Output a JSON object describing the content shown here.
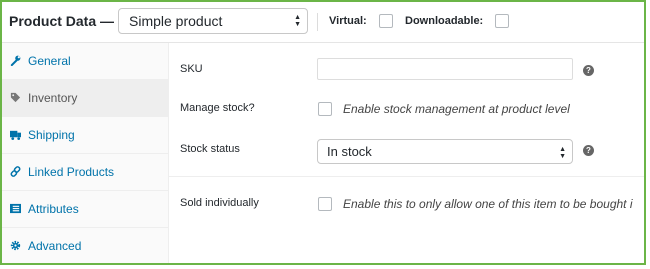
{
  "header": {
    "title": "Product Data —",
    "product_type": "Simple product",
    "virtual_label": "Virtual:",
    "downloadable_label": "Downloadable:"
  },
  "tabs": [
    {
      "label": "General",
      "icon": "wrench-icon"
    },
    {
      "label": "Inventory",
      "icon": "tag-icon"
    },
    {
      "label": "Shipping",
      "icon": "truck-icon"
    },
    {
      "label": "Linked Products",
      "icon": "link-icon"
    },
    {
      "label": "Attributes",
      "icon": "list-icon"
    },
    {
      "label": "Advanced",
      "icon": "gear-icon"
    }
  ],
  "active_tab": "Inventory",
  "fields": {
    "sku": {
      "label": "SKU",
      "value": ""
    },
    "manage_stock": {
      "label": "Manage stock?",
      "description": "Enable stock management at product level"
    },
    "stock_status": {
      "label": "Stock status",
      "value": "In stock"
    },
    "sold_individually": {
      "label": "Sold individually",
      "description": "Enable this to only allow one of this item to be bought i"
    }
  },
  "help_symbol": "?",
  "colors": {
    "link": "#0073aa",
    "frame": "#6bb547",
    "active_tab_bg": "#eeeeee"
  }
}
